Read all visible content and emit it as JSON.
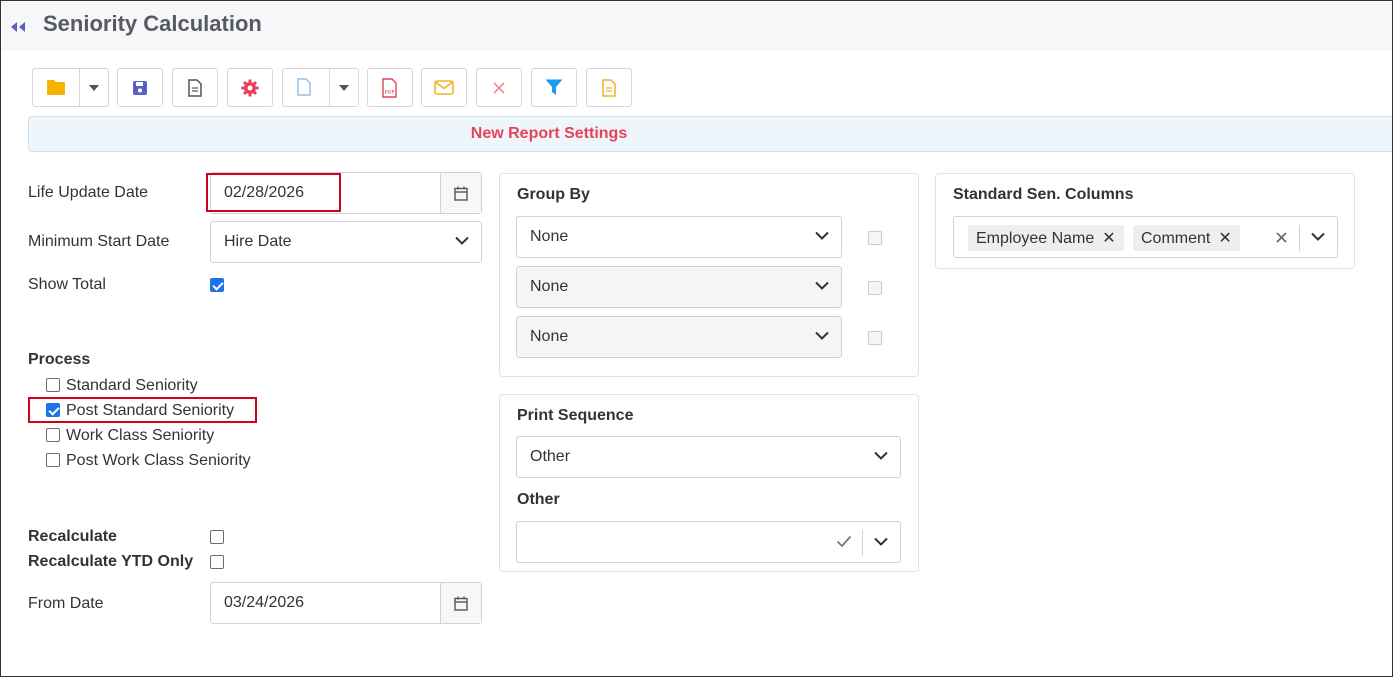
{
  "page": {
    "title": "Seniority Calculation"
  },
  "toolbar": {
    "buttons": [
      "open-folder",
      "save",
      "document",
      "settings",
      "new-document",
      "pdf",
      "email",
      "delete",
      "filter",
      "notes"
    ],
    "colors": {
      "folder": "#f5b400",
      "save": "#5a5fc8",
      "settings": "#e8425a",
      "pdf": "#e8425a",
      "email": "#f0b429",
      "delete": "#e8425a",
      "filter": "#1a9bf0",
      "notes": "#f0b429"
    }
  },
  "banner": {
    "text": "New Report Settings"
  },
  "form": {
    "life_update_date": {
      "label": "Life Update Date",
      "value": "02/28/2026"
    },
    "minimum_start_date": {
      "label": "Minimum Start Date",
      "value": "Hire Date"
    },
    "show_total": {
      "label": "Show Total",
      "checked": true
    },
    "process": {
      "heading": "Process",
      "options": [
        {
          "label": "Standard Seniority",
          "checked": false
        },
        {
          "label": "Post Standard Seniority",
          "checked": true
        },
        {
          "label": "Work Class Seniority",
          "checked": false
        },
        {
          "label": "Post Work Class Seniority",
          "checked": false
        }
      ]
    },
    "recalculate": {
      "label": "Recalculate",
      "checked": false
    },
    "recalculate_ytd": {
      "label": "Recalculate YTD Only",
      "checked": false
    },
    "from_date": {
      "label": "From Date",
      "value": "03/24/2026"
    }
  },
  "group_by": {
    "heading": "Group By",
    "selects": [
      {
        "value": "None"
      },
      {
        "value": "None"
      },
      {
        "value": "None"
      }
    ]
  },
  "print_sequence": {
    "heading": "Print Sequence",
    "value": "Other",
    "other_label": "Other",
    "other_value": ""
  },
  "standard_columns": {
    "heading": "Standard Sen. Columns",
    "tags": [
      "Employee Name",
      "Comment"
    ]
  }
}
